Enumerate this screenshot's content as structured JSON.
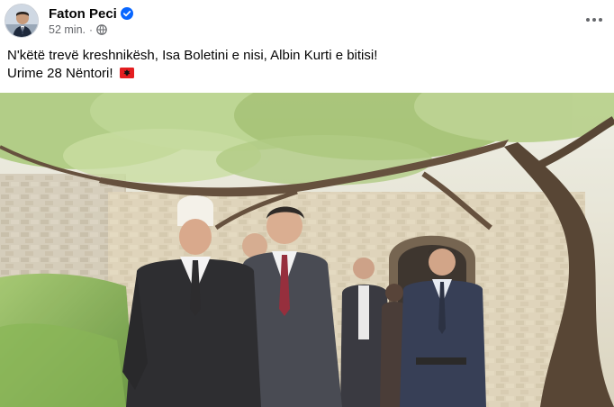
{
  "post": {
    "author": "Faton Peci",
    "time": "52 min.",
    "separator": "·",
    "text_line1": "N'këtë trevë kreshnikësh, Isa Boletini e nisi, Albin Kurti e bitisi!",
    "text_line2": "Urime 28 Nëntori!"
  },
  "icons": {
    "verified": "verified-badge-icon",
    "audience": "globe-icon",
    "more": "more-options-icon",
    "flag": "albania-flag-icon"
  },
  "colors": {
    "verified_blue": "#0866ff",
    "meta_gray": "#65676b",
    "flag_red": "#e41e20"
  }
}
